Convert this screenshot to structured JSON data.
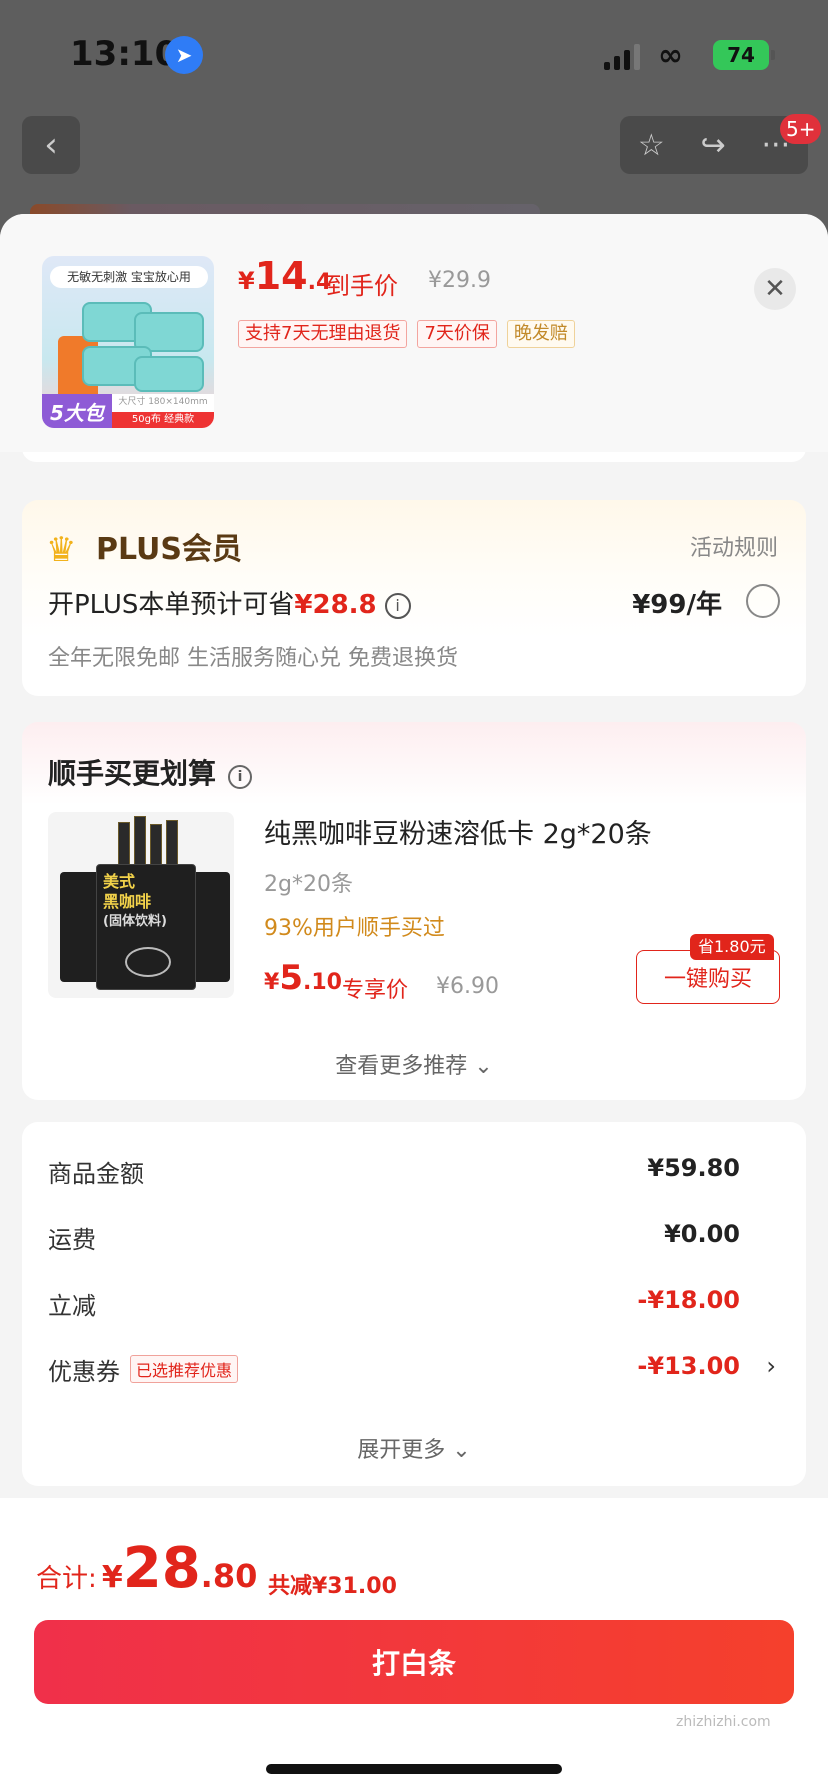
{
  "status_bar": {
    "time": "13:10",
    "battery": "74"
  },
  "nav": {
    "badge": "5+"
  },
  "product": {
    "thumb_banner": "无敏无刺激 宝宝放心用",
    "thumb_tag": "5大包",
    "thumb_spec": "大尺寸 180×140mm",
    "thumb_weight": "50g布 经典款",
    "price_symbol": "¥",
    "price_int": "14",
    "price_dec": ".4",
    "price_label": "到手价",
    "original_price": "¥29.9",
    "service_tags": [
      "支持7天无理由退货",
      "7天价保",
      "晚发赔"
    ]
  },
  "plus": {
    "title": "PLUS会员",
    "rule_link": "活动规则",
    "save_text": "开PLUS本单预计可省",
    "save_amount": "¥28.8",
    "price": "¥99/年",
    "benefits": "全年无限免邮 生活服务随心兑 免费退换货"
  },
  "recommend": {
    "title": "顺手买更划算",
    "item": {
      "name": "纯黑咖啡豆粉速溶低卡 2g*20条",
      "spec": "2g*20条",
      "social": "93%用户顺手买过",
      "price_symbol": "¥",
      "price_int": "5",
      "price_dec": ".10",
      "price_label": "专享价",
      "original_price": "¥6.90",
      "save_badge": "省1.80元",
      "buy_label": "一键购买",
      "img_text_1": "美式",
      "img_text_2": "黑咖啡",
      "img_text_3": "(固体饮料)"
    },
    "more": "查看更多推荐 ⌄"
  },
  "summary": {
    "rows": [
      {
        "label": "商品金额",
        "value": "¥59.80"
      },
      {
        "label": "运费",
        "value": "¥0.00"
      },
      {
        "label": "立减",
        "value": "-¥18.00"
      },
      {
        "label": "优惠券",
        "value": "-¥13.00",
        "tag": "已选推荐优惠"
      }
    ],
    "expand": "展开更多 ⌄"
  },
  "footer": {
    "total_label": "合计:",
    "total_symbol": "¥",
    "total_int": "28",
    "total_dec": ".80",
    "total_saved": "共减¥31.00",
    "pay_label": "打白条",
    "watermark": "zhizhizhi.com"
  },
  "colors": {
    "accent": "#e1251b",
    "gold": "#c28a2a",
    "battery": "#34c759"
  }
}
